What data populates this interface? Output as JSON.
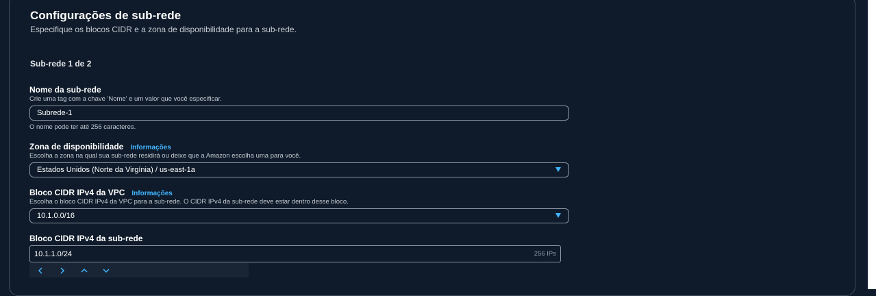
{
  "section": {
    "title": "Configurações de sub-rede",
    "description": "Especifique os blocos CIDR e a zona de disponibilidade para a sub-rede.",
    "subheading": "Sub-rede 1 de 2"
  },
  "subnet_name": {
    "label": "Nome da sub-rede",
    "hint": "Crie uma tag com a chave 'Nome' e um valor que você especificar.",
    "value": "Subrede-1",
    "constraint": "O nome pode ter até 256 caracteres."
  },
  "availability_zone": {
    "label": "Zona de disponibilidade",
    "info": "Informações",
    "hint": "Escolha a zona na qual sua sub-rede residirá ou deixe que a Amazon escolha uma para você.",
    "value": "Estados Unidos (Norte da Virgínia) / us-east-1a"
  },
  "vpc_cidr": {
    "label": "Bloco CIDR IPv4 da VPC",
    "info": "Informações",
    "hint": "Escolha o bloco CIDR IPv4 da VPC para a sub-rede. O CIDR IPv4 da sub-rede deve estar dentro desse bloco.",
    "value": "10.1.0.0/16"
  },
  "subnet_cidr": {
    "label": "Bloco CIDR IPv4 da sub-rede",
    "value": "10.1.1.0/24",
    "ip_count": "256 IPs"
  },
  "icons": [
    "chevron-left-icon",
    "chevron-right-icon",
    "chevron-up-icon",
    "chevron-down-icon",
    "caret-down-icon"
  ],
  "colors": {
    "background": "#0f1b2a",
    "accent": "#42b4ff",
    "border": "#8c96a3"
  }
}
